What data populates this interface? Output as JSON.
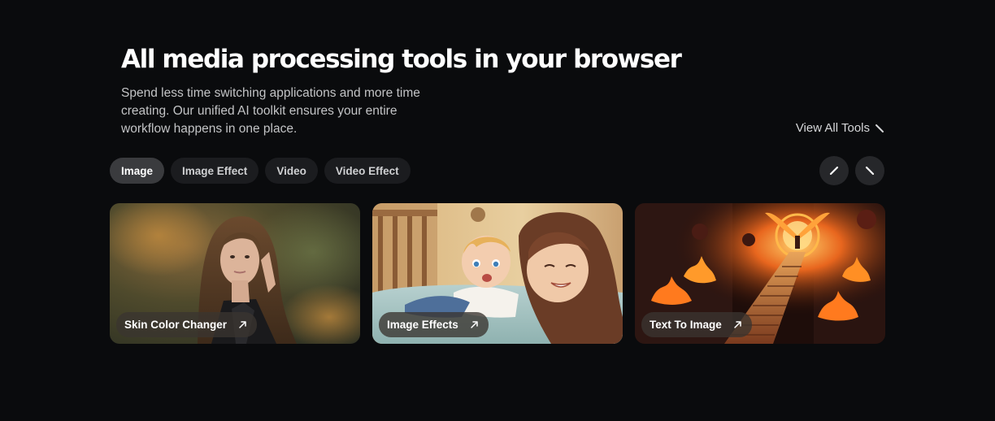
{
  "header": {
    "title": "All media processing tools in your browser",
    "subtitle": "Spend less time switching applications and more time creating. Our unified AI toolkit ensures your entire workflow happens in one place.",
    "view_all_label": "View All Tools"
  },
  "tabs": [
    {
      "label": "Image",
      "active": true
    },
    {
      "label": "Image Effect",
      "active": false
    },
    {
      "label": "Video",
      "active": false
    },
    {
      "label": "Video Effect",
      "active": false
    }
  ],
  "cards": [
    {
      "label": "Skin Color Changer",
      "image": "portrait of a woman with long brown hair in a leather jacket"
    },
    {
      "label": "Image Effects",
      "image": "cartoon of a baby and a smiling mother lying on a bed"
    },
    {
      "label": "Text To Image",
      "image": "fiery stone staircase leading to a glowing winged figure"
    }
  ],
  "icons": {
    "view_all": "arrow-down-right-icon",
    "prev": "arrow-prev-icon",
    "next": "arrow-next-icon",
    "card_link": "arrow-up-right-icon"
  },
  "colors": {
    "background": "#0a0b0d",
    "tab_active": "#3a3b3e",
    "tab": "#1b1c1f",
    "nav_button": "#26272a"
  }
}
